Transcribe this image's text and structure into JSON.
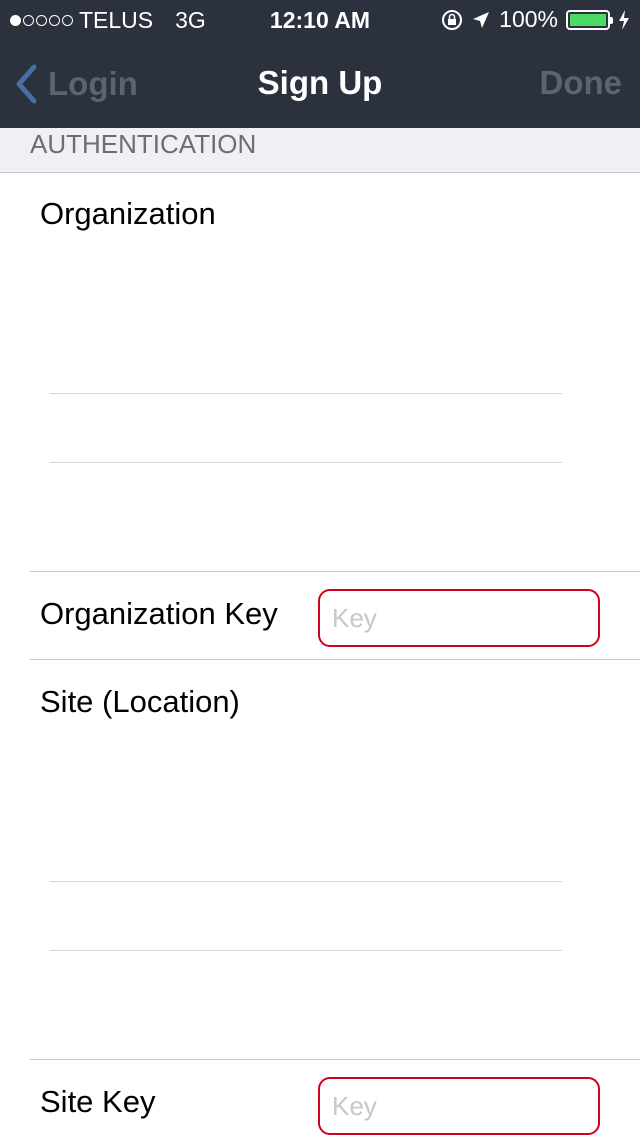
{
  "status_bar": {
    "signal_filled": 1,
    "signal_total": 5,
    "carrier": "TELUS",
    "network": "3G",
    "time": "12:10 AM",
    "battery_percent": "100%",
    "battery_level": 1.0,
    "battery_color": "#4cd964",
    "icons": [
      "rotation-lock-icon",
      "location-arrow-icon",
      "battery-icon",
      "charging-bolt-icon"
    ]
  },
  "nav": {
    "back_label": "Login",
    "title": "Sign Up",
    "done_label": "Done"
  },
  "section": {
    "header": "AUTHENTICATION"
  },
  "form": {
    "organization_label": "Organization",
    "organization_key_label": "Organization Key",
    "organization_key_value": "",
    "organization_key_placeholder": "Key",
    "site_label": "Site (Location)",
    "site_key_label": "Site Key",
    "site_key_value": "",
    "site_key_placeholder": "Key"
  },
  "colors": {
    "bar_background": "#2b313d",
    "error_border": "#d0021b",
    "section_background": "#efeff4"
  }
}
